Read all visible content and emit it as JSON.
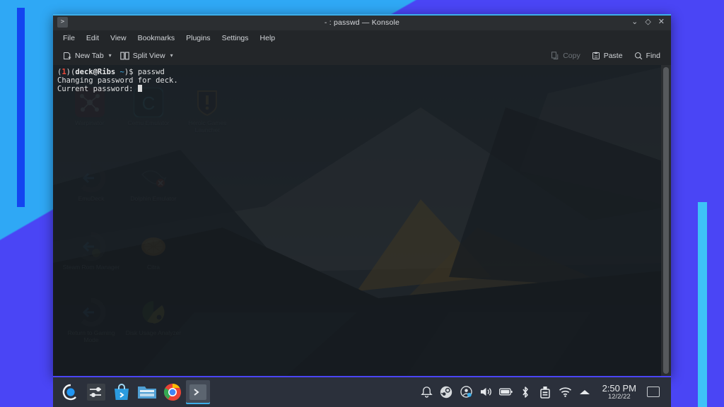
{
  "window": {
    "title": "- : passwd — Konsole",
    "app_icon": "terminal-icon",
    "controls": {
      "minimize": "⌄",
      "maximize": "◇",
      "close": "✕"
    }
  },
  "menubar": {
    "items": [
      {
        "label": "File"
      },
      {
        "label": "Edit"
      },
      {
        "label": "View"
      },
      {
        "label": "Bookmarks"
      },
      {
        "label": "Plugins"
      },
      {
        "label": "Settings"
      },
      {
        "label": "Help"
      }
    ]
  },
  "toolbar": {
    "new_tab": "New Tab",
    "split_view": "Split View",
    "copy": "Copy",
    "paste": "Paste",
    "find": "Find"
  },
  "terminal": {
    "prompt_open": "(",
    "prompt_status": "1",
    "prompt_mid": ")(",
    "prompt_user": "deck@Ribs",
    "prompt_tilde": "~",
    "prompt_close": ")$ ",
    "command": "passwd",
    "line2": "Changing password for deck.",
    "line3": "Current password:"
  },
  "desktop": {
    "icons": [
      {
        "label": "Warpinator",
        "glyph": "warpinator-icon"
      },
      {
        "label": "Cemu Emulator",
        "glyph": "cemu-icon"
      },
      {
        "label": "Heroic Games Launcher",
        "glyph": "heroic-icon"
      },
      {
        "label": "EmuDeck",
        "glyph": "emudeck-icon"
      },
      {
        "label": "Dolphin Emulator",
        "glyph": "dolphin-emulator-icon"
      },
      {
        "label": "Steam Rom Manager",
        "glyph": "steam-rom-manager-icon"
      },
      {
        "label": "Citra",
        "glyph": "citra-icon"
      },
      {
        "label": "Return to Gaming Mode",
        "glyph": "return-gaming-mode-icon"
      },
      {
        "label": "Disk Usage Analyzer",
        "glyph": "disk-usage-analyzer-icon"
      }
    ]
  },
  "panel": {
    "tasks": [
      {
        "name": "application-launcher",
        "label": "Application Launcher"
      },
      {
        "name": "system-settings",
        "label": "System Settings"
      },
      {
        "name": "discover-store",
        "label": "Discover"
      },
      {
        "name": "file-manager",
        "label": "Dolphin File Manager"
      },
      {
        "name": "chrome-browser",
        "label": "Google Chrome"
      },
      {
        "name": "konsole-task",
        "label": "Konsole",
        "active": true
      }
    ],
    "tray": [
      {
        "name": "notifications-icon",
        "label": "Notifications"
      },
      {
        "name": "steam-icon",
        "label": "Steam"
      },
      {
        "name": "user-status-icon",
        "label": "User"
      },
      {
        "name": "volume-icon",
        "label": "Volume"
      },
      {
        "name": "battery-icon",
        "label": "Battery"
      },
      {
        "name": "bluetooth-icon",
        "label": "Bluetooth"
      },
      {
        "name": "usb-device-icon",
        "label": "Removable Device"
      },
      {
        "name": "wifi-icon",
        "label": "Network"
      },
      {
        "name": "tray-expand-icon",
        "label": "Show hidden icons"
      }
    ],
    "clock": {
      "time": "2:50 PM",
      "date": "12/2/22"
    },
    "show_desktop": "Show Desktop"
  },
  "colors": {
    "accent": "#3daee9",
    "window_bg": "#232629",
    "panel_bg": "#2b303b",
    "panel_accent": "#4a45f5",
    "backdrop_cyan": "#2fa8f5",
    "backdrop_purple": "#4a45f5",
    "prompt_red": "#ee4b3b"
  }
}
